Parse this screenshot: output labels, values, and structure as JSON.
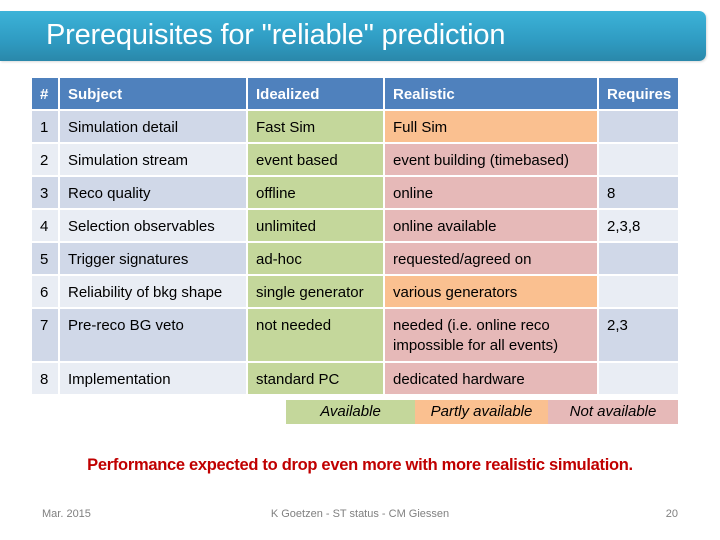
{
  "slide": {
    "title": "Prerequisites for \"reliable\" prediction",
    "colors": {
      "title_bar": "#33a3cb",
      "header": "#4f81bd",
      "row_odd": "#d0d8e8",
      "row_even": "#e9edf4",
      "available": "#c4d79b",
      "partly_available": "#fac090",
      "not_available": "#e6b9b8",
      "note": "#c00000"
    }
  },
  "table": {
    "headers": [
      "#",
      "Subject",
      "Idealized",
      "Realistic",
      "Requires"
    ],
    "rows": [
      {
        "num": "1",
        "subject": "Simulation detail",
        "idealized": "Fast Sim",
        "realistic": "Full Sim",
        "requires": "",
        "idealized_status": "available",
        "realistic_status": "partly available"
      },
      {
        "num": "2",
        "subject": "Simulation stream",
        "idealized": "event based",
        "realistic": "event building (timebased)",
        "requires": "",
        "idealized_status": "available",
        "realistic_status": "not available"
      },
      {
        "num": "3",
        "subject": "Reco quality",
        "idealized": "offline",
        "realistic": "online",
        "requires": "8",
        "idealized_status": "available",
        "realistic_status": "not available"
      },
      {
        "num": "4",
        "subject": "Selection observables",
        "idealized": "unlimited",
        "realistic": "online available",
        "requires": "2,3,8",
        "idealized_status": "available",
        "realistic_status": "not available"
      },
      {
        "num": "5",
        "subject": "Trigger signatures",
        "idealized": "ad-hoc",
        "realistic": "requested/agreed on",
        "requires": "",
        "idealized_status": "available",
        "realistic_status": "not available"
      },
      {
        "num": "6",
        "subject": "Reliability of bkg shape",
        "idealized": "single generator",
        "realistic": "various generators",
        "requires": "",
        "idealized_status": "available",
        "realistic_status": "partly available"
      },
      {
        "num": "7",
        "subject": "Pre-reco BG veto",
        "idealized": "not needed",
        "realistic": "needed (i.e. online reco impossible for all events)",
        "requires": "2,3",
        "idealized_status": "available",
        "realistic_status": "not available"
      },
      {
        "num": "8",
        "subject": "Implementation",
        "idealized": "standard PC",
        "realistic": "dedicated hardware",
        "requires": "",
        "idealized_status": "available",
        "realistic_status": "not available"
      }
    ]
  },
  "legend": {
    "available": "Available",
    "partly": "Partly available",
    "not": "Not available"
  },
  "note": "Performance expected to drop even more with more realistic simulation.",
  "footer": {
    "date": "Mar. 2015",
    "center": "K Goetzen - ST status - CM Giessen",
    "page": "20"
  }
}
